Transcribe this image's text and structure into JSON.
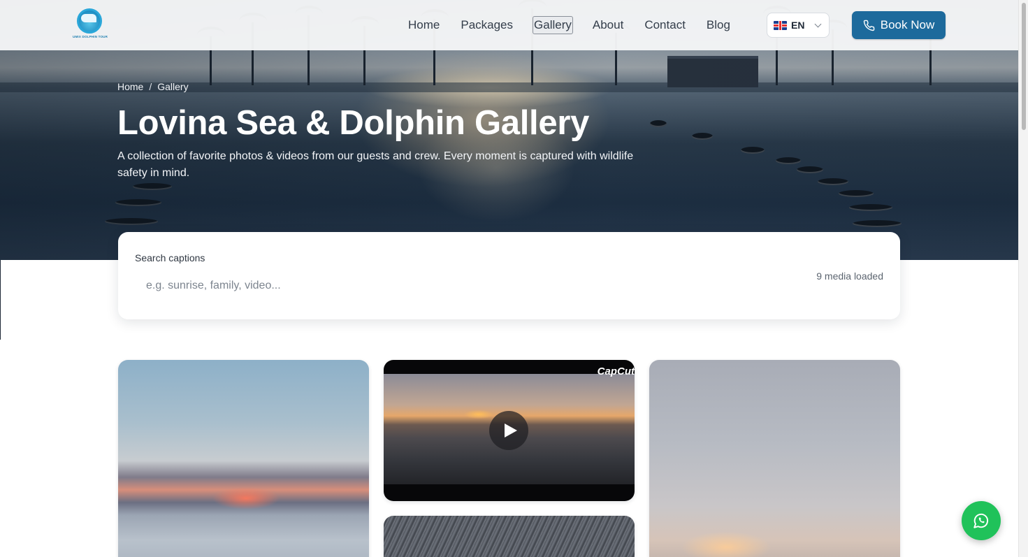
{
  "brand": {
    "logo_text": "UMIX DOLPHIN TOUR"
  },
  "nav": {
    "links": [
      {
        "label": "Home"
      },
      {
        "label": "Packages"
      },
      {
        "label": "Gallery"
      },
      {
        "label": "About"
      },
      {
        "label": "Contact"
      },
      {
        "label": "Blog"
      }
    ],
    "active": "Gallery",
    "language": {
      "code": "EN",
      "flag_icon": "uk-flag-icon"
    },
    "book_label": "Book Now",
    "book_icon": "phone-icon"
  },
  "hero": {
    "breadcrumb": {
      "home": "Home",
      "separator": "/",
      "current": "Gallery"
    },
    "title": "Lovina Sea & Dolphin Gallery",
    "subtitle": "A collection of favorite photos & videos from our guests and crew. Every moment is captured with wildlife safety in mind."
  },
  "search": {
    "label": "Search captions",
    "placeholder": "e.g. sunrise, family, video...",
    "value": "",
    "count_text": "9 media loaded"
  },
  "gallery": {
    "items": [
      {
        "type": "photo"
      },
      {
        "type": "video",
        "watermark": "CapCut"
      },
      {
        "type": "photo"
      },
      {
        "type": "photo"
      }
    ]
  },
  "floating": {
    "whatsapp_icon": "whatsapp-icon"
  },
  "colors": {
    "primary": "#1d6a9c",
    "whatsapp": "#20c25a"
  }
}
